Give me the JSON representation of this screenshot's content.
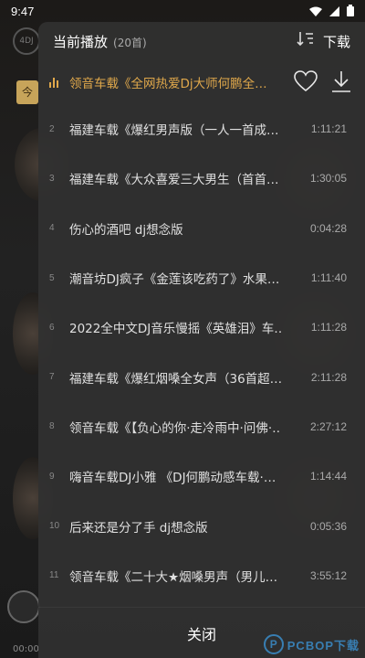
{
  "status_bar": {
    "time": "9:47"
  },
  "background": {
    "logo_text": "4DJ",
    "tag_text": "今",
    "mini_player_time": "00:00"
  },
  "playlist": {
    "title": "当前播放",
    "count": "(20首)",
    "download_label": "下载",
    "close_label": "关闭",
    "accent_color": "#e0a84b",
    "tracks": [
      {
        "index": "",
        "title": "领音车载《全网热爱Dj大师何鹏全…",
        "duration": "",
        "active": true
      },
      {
        "index": "2",
        "title": "福建车载《爆红男声版（一人一首成…",
        "duration": "1:11:21"
      },
      {
        "index": "3",
        "title": "福建车载《大众喜爱三大男生（首首…",
        "duration": "1:30:05"
      },
      {
        "index": "4",
        "title": "伤心的酒吧 dj想念版",
        "duration": "0:04:28"
      },
      {
        "index": "5",
        "title": "潮音坊DJ疯子《金莲该吃药了》水果…",
        "duration": "1:11:40"
      },
      {
        "index": "6",
        "title": "2022全中文DJ音乐慢摇《英雄泪》车…",
        "duration": "1:11:28"
      },
      {
        "index": "7",
        "title": "福建车载《爆红烟嗓全女声（36首超…",
        "duration": "2:11:28"
      },
      {
        "index": "8",
        "title": "领音车载《【负心的你·走冷雨中·问佛·…",
        "duration": "2:27:12"
      },
      {
        "index": "9",
        "title": "嗨音车载DJ小雅 《DJ何鹏动感车载·…",
        "duration": "1:14:44"
      },
      {
        "index": "10",
        "title": "后来还是分了手 dj想念版",
        "duration": "0:05:36"
      },
      {
        "index": "11",
        "title": "领音车载《二十大★烟嗓男声（男儿…",
        "duration": "3:55:12"
      }
    ]
  },
  "watermark": {
    "badge": "P",
    "text": "PCBOP下载"
  }
}
